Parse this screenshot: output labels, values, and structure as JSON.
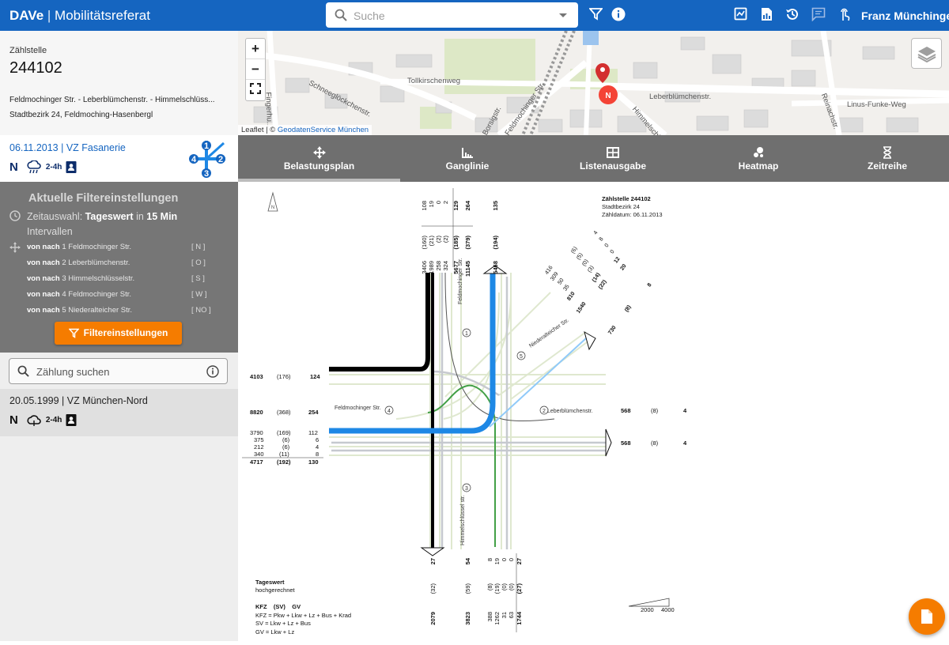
{
  "app": {
    "name": "DAVe",
    "separator": "|",
    "subtitle": "Mobilitätsreferat"
  },
  "header": {
    "search_placeholder": "Suche",
    "user": "Franz Münchinger",
    "icons": [
      "filter-icon",
      "info-icon",
      "report-icon",
      "pdf-icon",
      "history-icon",
      "chat-icon",
      "touch-icon"
    ]
  },
  "sidebar": {
    "zaehlstelle_label": "Zählstelle",
    "zaehlstelle_nr": "244102",
    "address": "Feldmochinger Str. - Leberblümchenstr. - Himmelschlüss...",
    "bezirk": "Stadtbezirk 24, Feldmoching-Hasenbergl",
    "selected_count": {
      "title": "06.11.2013 | VZ Fasanerie",
      "n": "N",
      "range": "2-4h"
    },
    "filter": {
      "title": "Aktuelle Filtereinstellungen",
      "zeit_prefix": "Zeitauswahl:",
      "zeit_value": "Tageswert",
      "zeit_mid": "in",
      "zeit_int": "15 Min",
      "zeit_suffix": "Intervallen",
      "rows": [
        {
          "vonnach": "von nach",
          "arm": "1 Feldmochinger Str.",
          "code": "[ N ]"
        },
        {
          "vonnach": "von nach",
          "arm": "2 Leberblümchenstr.",
          "code": "[ O ]"
        },
        {
          "vonnach": "von nach",
          "arm": "3 Himmelschlüsselstr.",
          "code": "[ S ]"
        },
        {
          "vonnach": "von nach",
          "arm": "4 Feldmochinger Str.",
          "code": "[ W ]"
        },
        {
          "vonnach": "von nach",
          "arm": "5 Niederalteicher Str.",
          "code": "[ NO ]"
        }
      ],
      "button": "Filtereinstellungen"
    },
    "search_placeholder": "Zählung suchen",
    "other_count": {
      "title": "20.05.1999 | VZ München-Nord",
      "n": "N",
      "range": "2-4h"
    }
  },
  "map": {
    "attribution_prefix": "Leaflet | ©",
    "attribution_link": "GeodatenService München",
    "marker_label": "N",
    "streets": [
      "Schneeglöckchenstr.",
      "Tollkirschenweg",
      "Leberblümchenstr.",
      "Linus-Funke-Weg",
      "Reinachstr.",
      "Feldmochinger Str.",
      "Borsigstr.",
      "Himmelschl...",
      "Fingerhu..."
    ],
    "zoom_in": "+",
    "zoom_out": "−"
  },
  "tabs": [
    {
      "label": "Belastungsplan",
      "icon": "arrows-icon",
      "active": true
    },
    {
      "label": "Ganglinie",
      "icon": "chart-icon",
      "active": false
    },
    {
      "label": "Listenausgabe",
      "icon": "table-icon",
      "active": false
    },
    {
      "label": "Heatmap",
      "icon": "heatmap-icon",
      "active": false
    },
    {
      "label": "Zeitreihe",
      "icon": "hourglass-icon",
      "active": false
    }
  ],
  "plan": {
    "info": [
      "Zählstelle 244102",
      "Stadtbezirk 24",
      "Zähldatum: 06.11.2013"
    ],
    "north": [
      "108",
      "19",
      "0",
      "2",
      "129",
      "264",
      "135",
      "(160)",
      "(21)",
      "(2)",
      "(2)",
      "(185)",
      "(379)",
      "(194)",
      "3406",
      "1989",
      "258",
      "324",
      "5677",
      "11145",
      "5468"
    ],
    "ne_vals": [
      "416",
      "309",
      "50",
      "35",
      "810",
      "1540",
      "(6)",
      "(5)",
      "(0)",
      "(3)",
      "(14)",
      "(22)",
      "(8)",
      "4",
      "8",
      "0",
      "0",
      "12",
      "20",
      "8",
      "730"
    ],
    "west": [
      "4103",
      "(176)",
      "124",
      "8820",
      "(368)",
      "254",
      "3790",
      "375",
      "212",
      "340",
      "4717",
      "(169)",
      "(6)",
      "(6)",
      "(11)",
      "(192)",
      "112",
      "6",
      "4",
      "8",
      "130"
    ],
    "east": [
      "568",
      "(8)",
      "4",
      "568",
      "(8)",
      "4"
    ],
    "south": [
      "27",
      "54",
      "8",
      "19",
      "0",
      "0",
      "27",
      "(32)",
      "(59)",
      "(8)",
      "(19)",
      "(0)",
      "(0)",
      "(27)",
      "2079",
      "3823",
      "388",
      "1262",
      "31",
      "63",
      "1744"
    ],
    "street_labels": {
      "north": "Feldmochinger Str.",
      "ne": "Niederalteicher Str.",
      "west": "Feldmochinger Str.",
      "east": "Leberblümchenstr.",
      "south": "Himmelschlüssel str."
    },
    "arm_numbers": [
      "1",
      "2",
      "3",
      "4",
      "5"
    ],
    "legend": [
      "Tageswert",
      "hochgerechnet",
      "KFZ    (SV)    GV",
      "KFZ = Pkw + Lkw + Lz + Bus + Krad",
      "SV = Lkw + Lz + Bus",
      "GV = Lkw + Lz"
    ],
    "scale": [
      "2000",
      "4000"
    ]
  },
  "colors": {
    "brand": "#1565c0",
    "accent": "#f57c00",
    "flow_n": "#1e88e5",
    "flow_w": "#000000",
    "flow_s": "#43a047"
  }
}
